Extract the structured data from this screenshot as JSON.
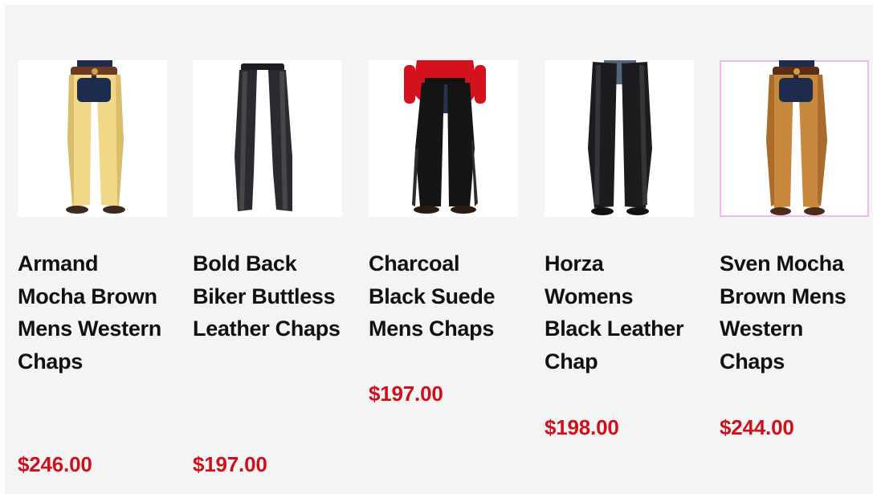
{
  "products": [
    {
      "name": "Armand Mocha Brown Mens Western Chaps",
      "price": "$246.00",
      "image_icon": "tan-leather-chaps-image",
      "colors": {
        "leg": "#f1d889",
        "leg_shade": "#d9bd6c",
        "belt": "#6d3b22",
        "jeans": "#1d2b4d",
        "boots": "#3e2a1c"
      }
    },
    {
      "name": "Bold Back Biker Buttless Leather Chaps",
      "price": "$197.00",
      "image_icon": "black-biker-chaps-image",
      "colors": {
        "leg": "#2a2b2e",
        "leg_shade": "#45474b",
        "belt": "#1d1d1f"
      }
    },
    {
      "name": "Charcoal Black Suede Mens Chaps",
      "price": "$197.00",
      "image_icon": "black-suede-fringe-chaps-image",
      "colors": {
        "leg": "#151515",
        "leg_shade": "#2d2d2d",
        "shirt": "#d4121d",
        "jeans": "#25334f",
        "boots": "#2c1b12"
      }
    },
    {
      "name": "Horza Womens Black Leather Chap",
      "price": "$198.00",
      "image_icon": "womens-black-leather-chaps-image",
      "colors": {
        "leg": "#1b1c1e",
        "leg_shade": "#34363a",
        "jeans": "#56657e",
        "boots": "#111111"
      }
    },
    {
      "name": "Sven Mocha Brown Mens Western Chaps",
      "price": "$244.00",
      "image_icon": "mocha-brown-chaps-image",
      "colors": {
        "leg": "#c8893e",
        "leg_shade": "#a96c2a",
        "belt": "#5b2d17",
        "jeans": "#1d2b4d",
        "boots": "#4a2c18"
      }
    }
  ]
}
